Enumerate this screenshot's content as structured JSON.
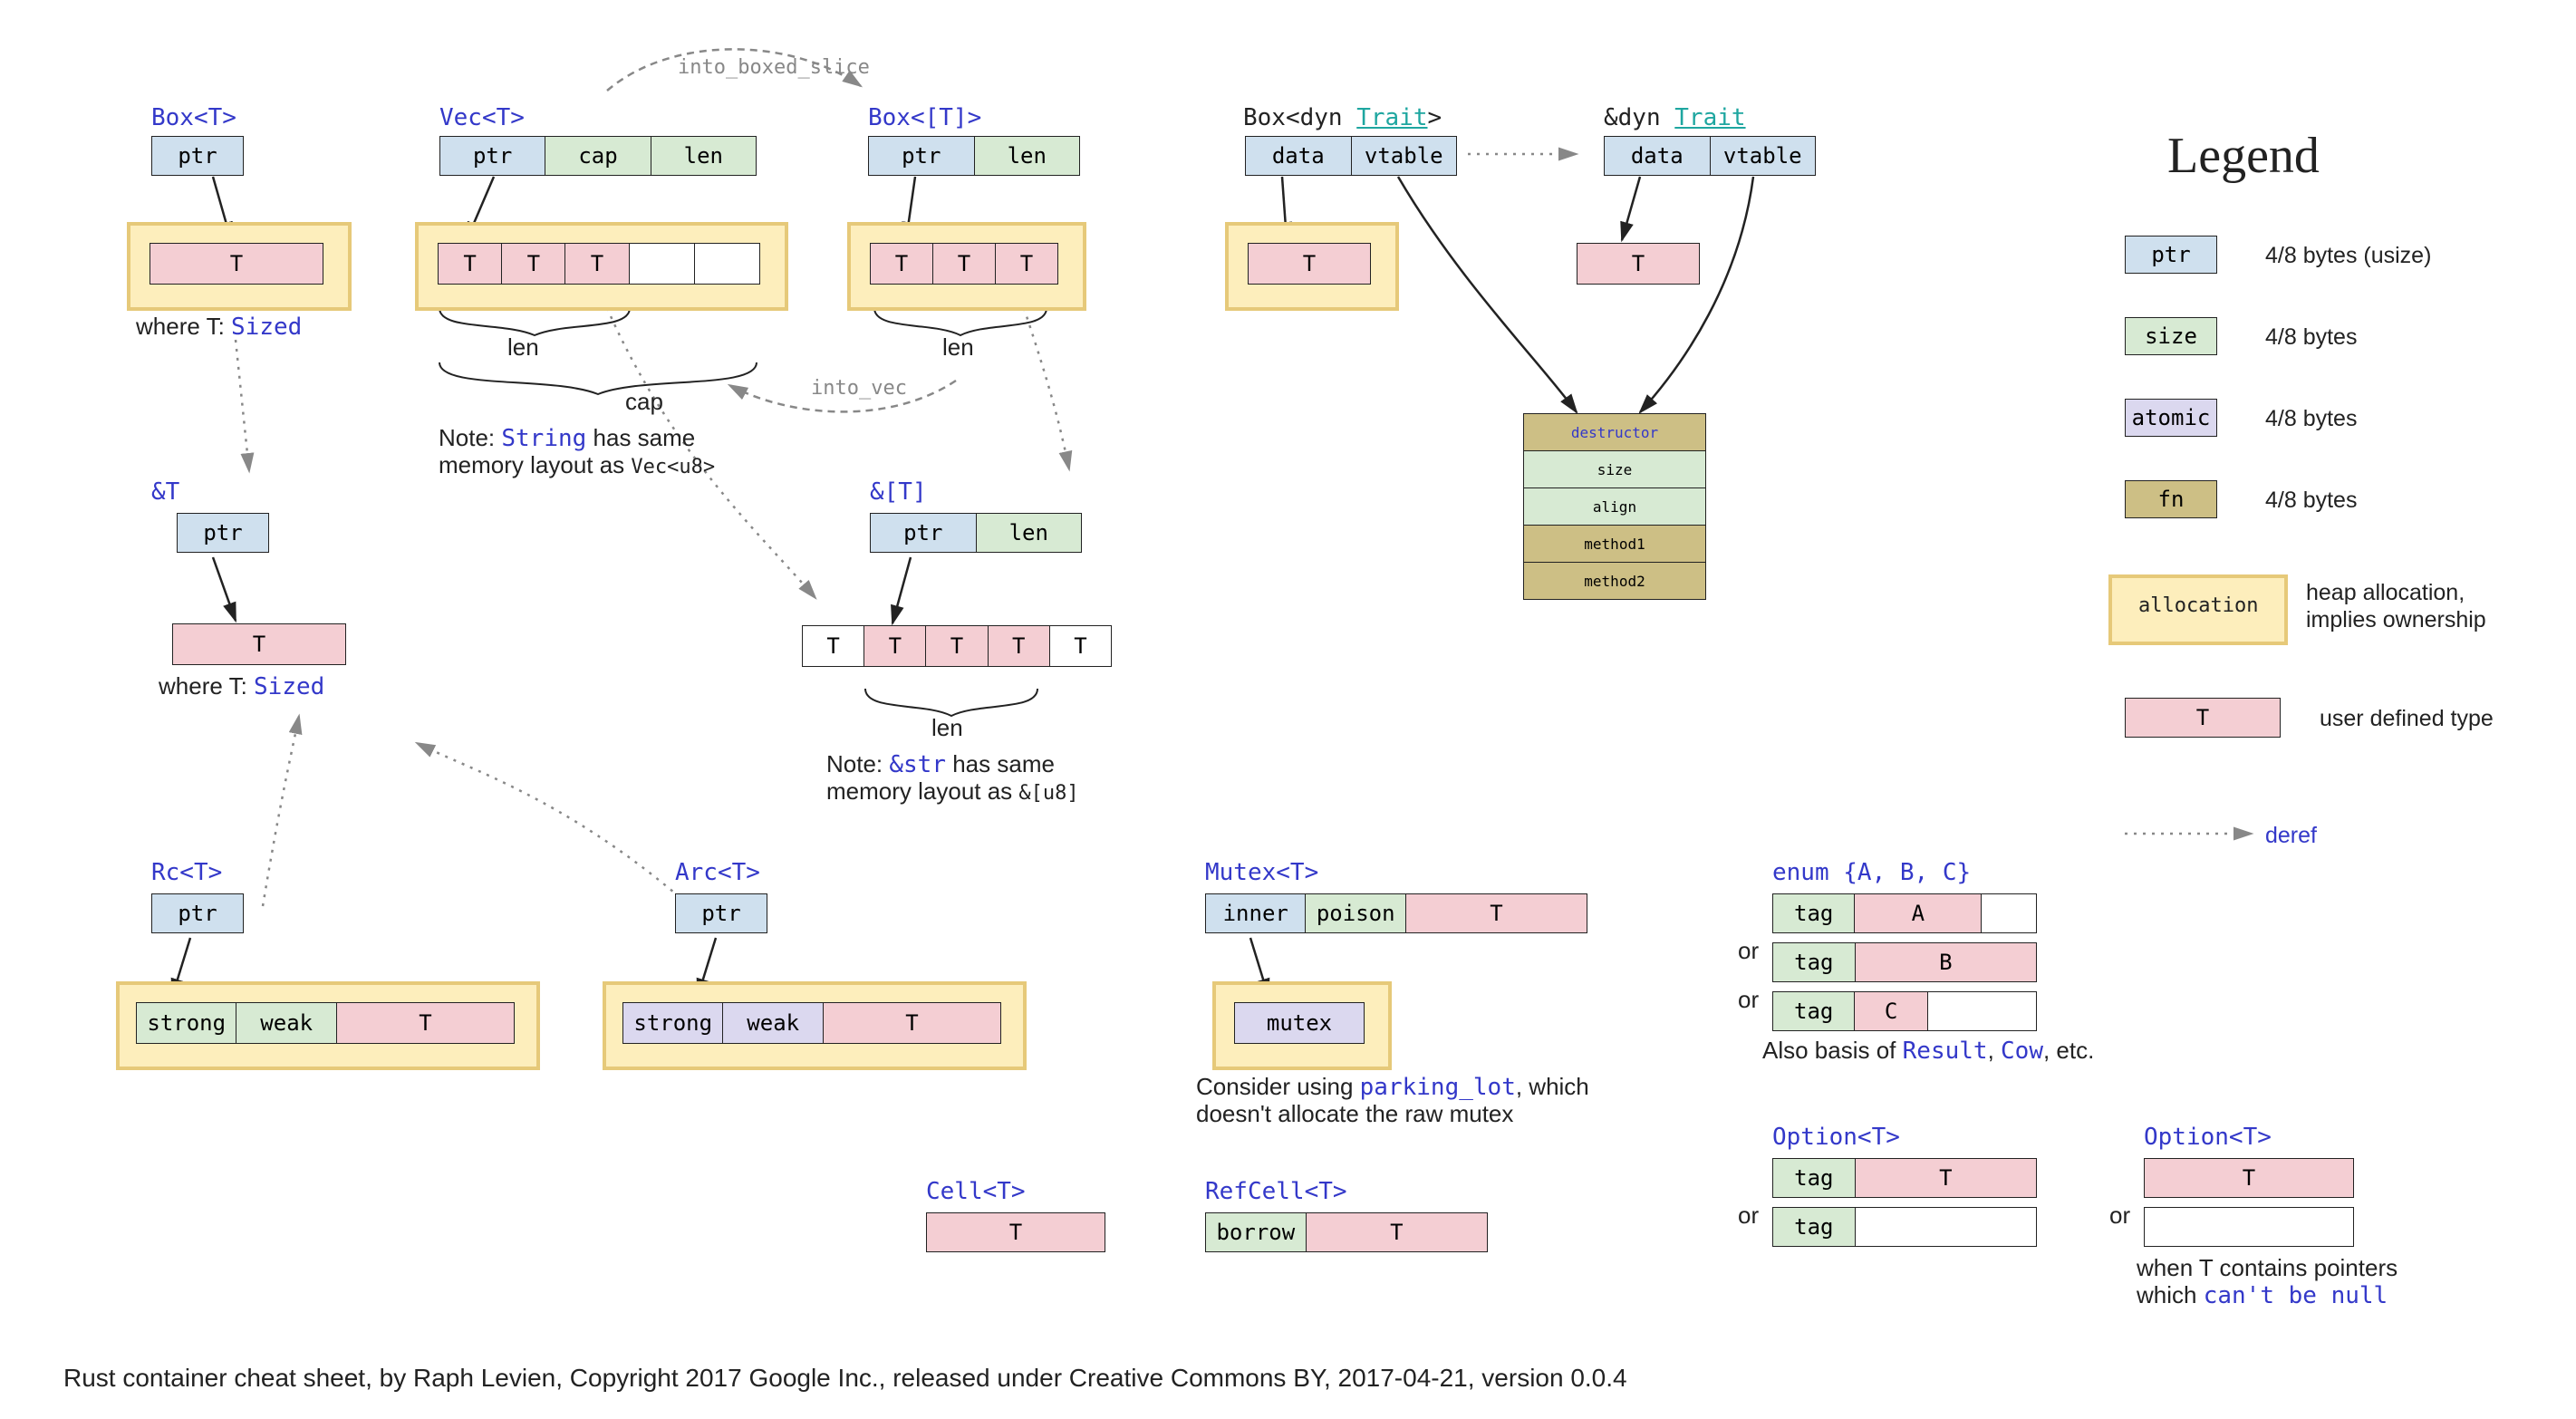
{
  "arrows": {
    "into_boxed_slice": "into_boxed_slice",
    "into_vec": "into_vec"
  },
  "box_t": {
    "title": "Box<T>",
    "ptr": "ptr",
    "t": "T",
    "where": "where T: ",
    "sized": "Sized"
  },
  "ref_t": {
    "title": "&T",
    "ptr": "ptr",
    "t": "T",
    "where": "where T: ",
    "sized": "Sized"
  },
  "vec": {
    "title": "Vec<T>",
    "ptr": "ptr",
    "cap": "cap",
    "len": "len",
    "t": "T",
    "len_brace": "len",
    "cap_brace": "cap",
    "note1": "Note: ",
    "note_string": "String",
    "note2": " has same",
    "note3": "memory layout as ",
    "note_vecu8": "Vec<u8>"
  },
  "box_slice": {
    "title": "Box<[T]>",
    "ptr": "ptr",
    "len": "len",
    "t": "T",
    "len_brace": "len"
  },
  "ref_slice": {
    "title": "&[T]",
    "ptr": "ptr",
    "len": "len",
    "t": "T",
    "len_brace": "len",
    "note1": "Note: ",
    "note_str": "&str",
    "note2": " has same",
    "note3": "memory layout as ",
    "note_u8": "&[u8]"
  },
  "box_dyn": {
    "title_prefix": "Box<dyn ",
    "trait": "Trait",
    "title_suffix": ">",
    "data": "data",
    "vtable": "vtable",
    "t": "T"
  },
  "ref_dyn": {
    "title_prefix": "&dyn ",
    "trait": "Trait",
    "data": "data",
    "vtable": "vtable",
    "t": "T"
  },
  "vtable": {
    "destructor": "destructor",
    "size": "size",
    "align": "align",
    "m1": "method1",
    "m2": "method2"
  },
  "rc": {
    "title": "Rc<T>",
    "ptr": "ptr",
    "strong": "strong",
    "weak": "weak",
    "t": "T"
  },
  "arc": {
    "title": "Arc<T>",
    "ptr": "ptr",
    "strong": "strong",
    "weak": "weak",
    "t": "T"
  },
  "mutex": {
    "title": "Mutex<T>",
    "inner": "inner",
    "poison": "poison",
    "t": "T",
    "mutex": "mutex",
    "note1": "Consider using ",
    "parking": "parking_lot",
    "note2": ", which",
    "note3": "doesn't allocate the raw mutex"
  },
  "enum": {
    "title": "enum {A, B, C}",
    "tag": "tag",
    "a": "A",
    "b": "B",
    "c": "C",
    "or": "or",
    "note1": "Also basis of ",
    "result": "Result",
    "cow": "Cow",
    "note2": ", etc."
  },
  "cell": {
    "title": "Cell<T>",
    "t": "T"
  },
  "refcell": {
    "title": "RefCell<T>",
    "borrow": "borrow",
    "t": "T"
  },
  "option1": {
    "title": "Option<T>",
    "tag": "tag",
    "t": "T",
    "or": "or"
  },
  "option2": {
    "title": "Option<T>",
    "t": "T",
    "or": "or",
    "note1": "when T contains pointers",
    "note2": "which ",
    "null": "can't be null"
  },
  "legend": {
    "title": "Legend",
    "ptr": "ptr",
    "ptr_desc": "4/8 bytes (usize)",
    "size": "size",
    "size_desc": "4/8 bytes",
    "atomic": "atomic",
    "atomic_desc": "4/8 bytes",
    "fn": "fn",
    "fn_desc": "4/8 bytes",
    "alloc": "allocation",
    "alloc_desc1_kw": "heap",
    "alloc_desc1": " allocation,",
    "alloc_desc2": "implies ownership",
    "t": "T",
    "t_desc": "user defined type",
    "deref": "deref"
  },
  "footer": "Rust container cheat sheet, by Raph Levien, Copyright 2017 Google Inc., released under Creative Commons BY, 2017-04-21, version 0.0.4"
}
